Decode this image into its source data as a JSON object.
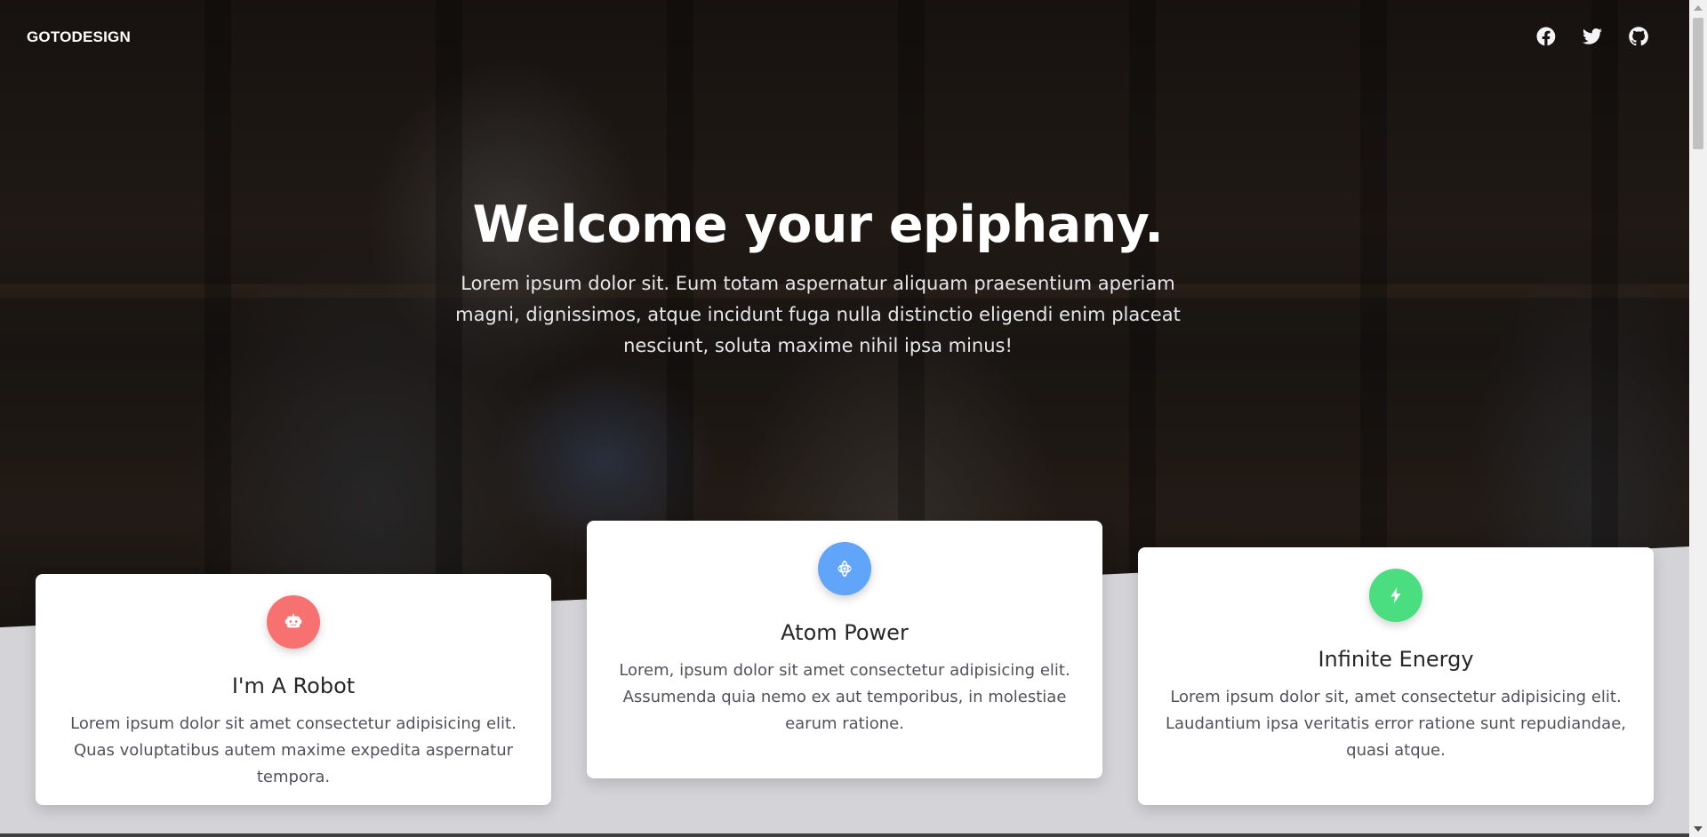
{
  "nav": {
    "brand": "GOTODESIGN",
    "social": [
      "facebook-icon",
      "twitter-icon",
      "github-icon"
    ]
  },
  "hero": {
    "title": "Welcome your epiphany.",
    "text": "Lorem ipsum dolor sit. Eum totam aspernatur aliquam praesentium aperiam magni, dignissimos, atque incidunt fuga nulla distinctio eligendi enim placeat nesciunt, soluta maxime nihil ipsa minus!"
  },
  "cards": [
    {
      "icon": "robot-icon",
      "color": "#f87171",
      "title": "I'm A Robot",
      "text": "Lorem ipsum dolor sit amet consectetur adipisicing elit. Quas voluptatibus autem maxime expedita aspernatur tempora."
    },
    {
      "icon": "atom-icon",
      "color": "#60a5fa",
      "title": "Atom Power",
      "text": "Lorem, ipsum dolor sit amet consectetur adipisicing elit. Assumenda quia nemo ex aut temporibus, in molestiae earum ratione."
    },
    {
      "icon": "bolt-icon",
      "color": "#4ade80",
      "title": "Infinite Energy",
      "text": "Lorem ipsum dolor sit, amet consectetur adipisicing elit. Laudantium ipsa veritatis error ratione sunt repudiandae, quasi atque."
    }
  ],
  "colors": {
    "page_background": "#d4d4d8",
    "card_background": "#ffffff"
  }
}
